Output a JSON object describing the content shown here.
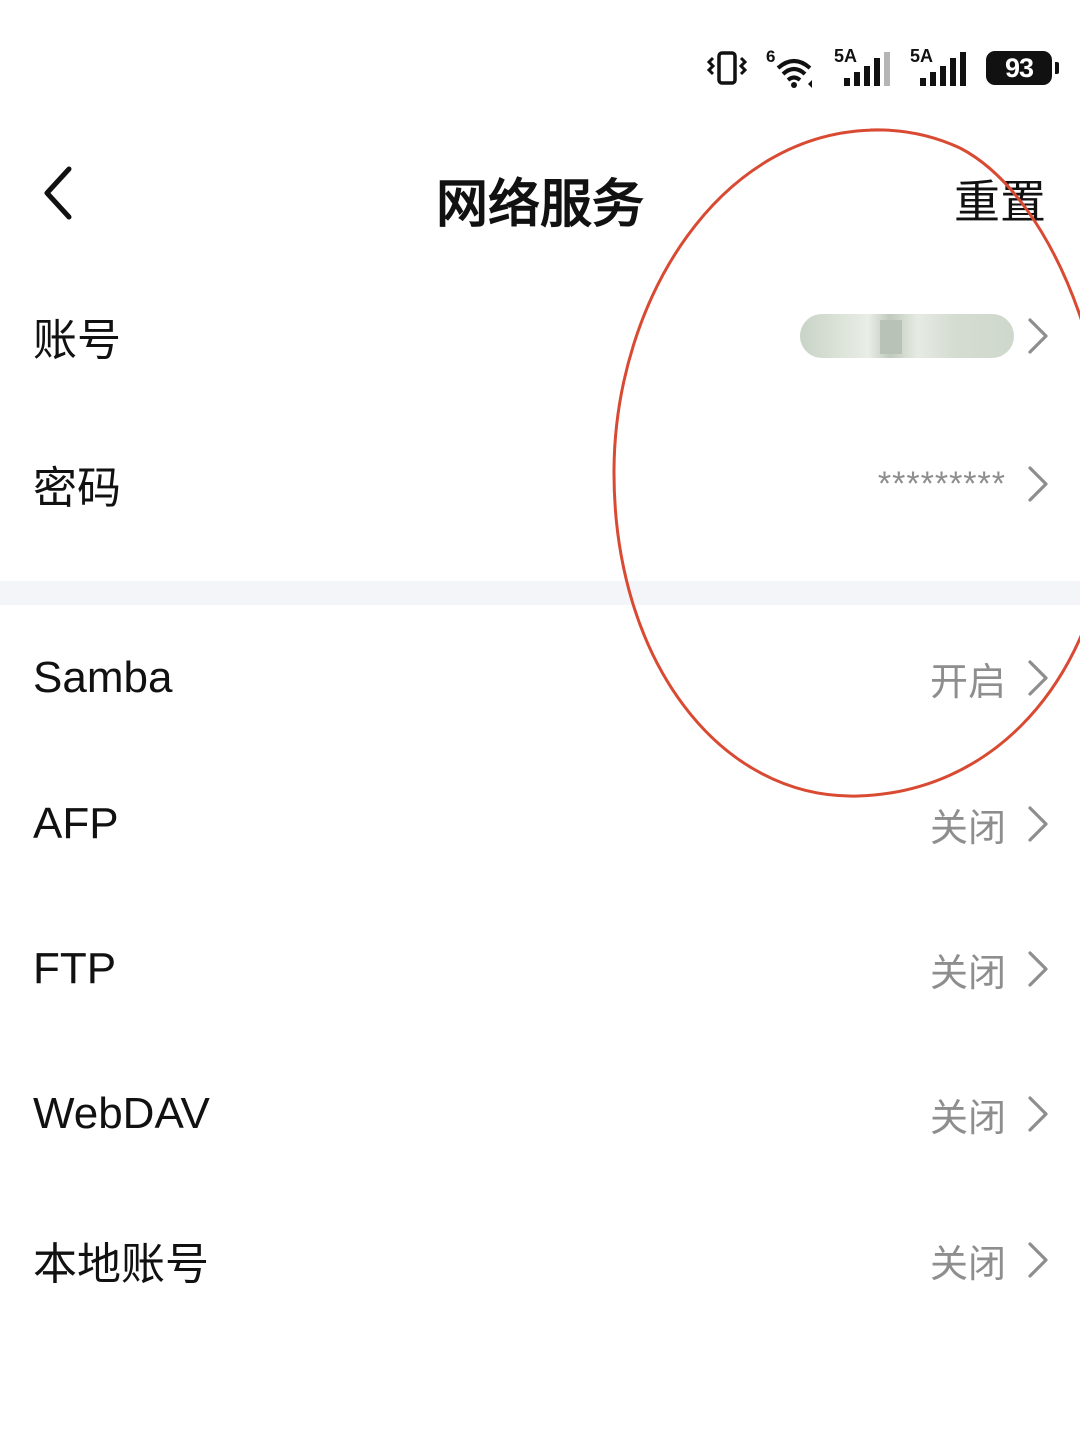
{
  "status_bar": {
    "icons": [
      "vibrate-icon",
      "wifi-6-icon",
      "signal-5a-icon",
      "signal-5a-icon"
    ],
    "wifi_label": "6",
    "signal_1_label": "5A",
    "signal_2_label": "5A",
    "battery_level": "93"
  },
  "header": {
    "back_icon": "chevron-left-icon",
    "title": "网络服务",
    "reset_label": "重置"
  },
  "account_section": {
    "rows": [
      {
        "label": "账号",
        "value": "",
        "value_blurred": true
      },
      {
        "label": "密码",
        "value": "*********"
      }
    ]
  },
  "services_section": {
    "rows": [
      {
        "label": "Samba",
        "value": "开启"
      },
      {
        "label": "AFP",
        "value": "关闭"
      },
      {
        "label": "FTP",
        "value": "关闭"
      },
      {
        "label": "WebDAV",
        "value": "关闭"
      },
      {
        "label": "本地账号",
        "value": "关闭"
      }
    ]
  },
  "colors": {
    "annotation": "#d94a33",
    "value_text": "#8e8e8e",
    "divider": "#f3f5f8"
  }
}
